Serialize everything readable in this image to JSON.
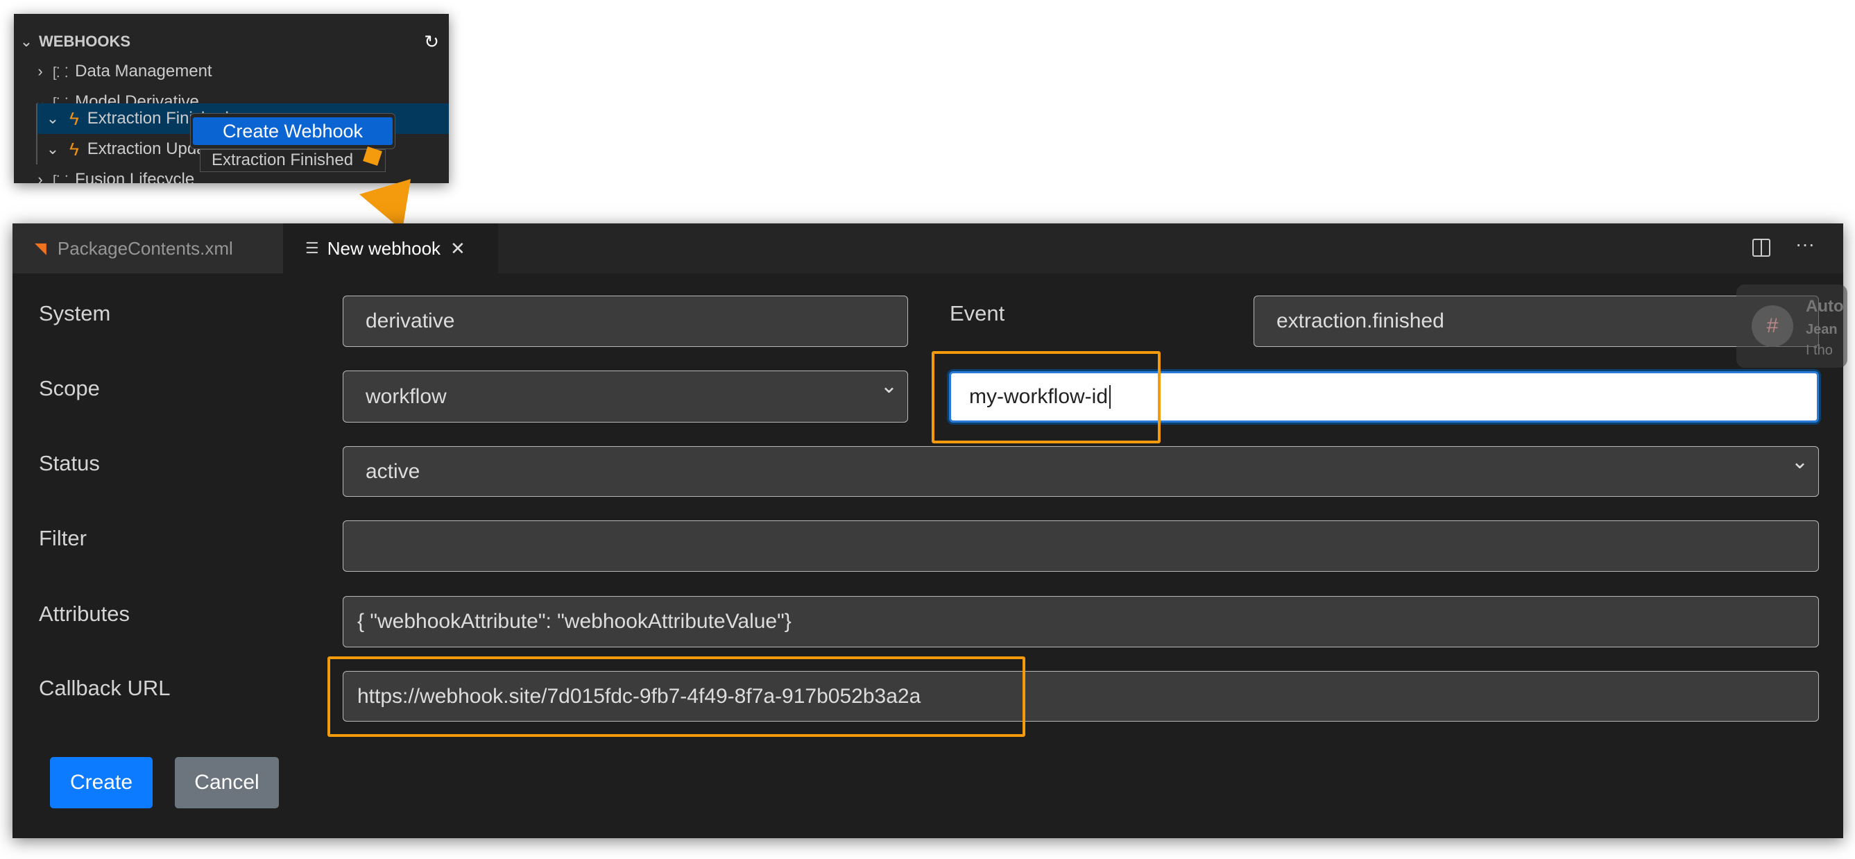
{
  "tree": {
    "section_title": "WEBHOOKS",
    "items": [
      {
        "label": "Data Management"
      },
      {
        "label": "Model Derivative"
      },
      {
        "label": "Extraction Finished"
      },
      {
        "label": "Extraction Updated"
      },
      {
        "label": "Fusion Lifecycle"
      }
    ],
    "context_menu": {
      "item": "Create Webhook"
    },
    "tooltip": "Extraction Finished"
  },
  "tabs": [
    {
      "label": "PackageContents.xml",
      "active": false
    },
    {
      "label": "New webhook",
      "active": true
    }
  ],
  "form": {
    "system": {
      "label": "System",
      "value": "derivative"
    },
    "event": {
      "label": "Event",
      "value": "extraction.finished"
    },
    "scope": {
      "label": "Scope",
      "value": "workflow",
      "scope_value": "my-workflow-id"
    },
    "status": {
      "label": "Status",
      "value": "active"
    },
    "filter": {
      "label": "Filter",
      "value": ""
    },
    "attributes": {
      "label": "Attributes",
      "value": "{ \"webhookAttribute\": \"webhookAttributeValue\"}"
    },
    "callback": {
      "label": "Callback URL",
      "value": "https://webhook.site/7d015fdc-9fb7-4f49-8f7a-917b052b3a2a"
    },
    "create_label": "Create",
    "cancel_label": "Cancel"
  },
  "notification": {
    "title": "Auto",
    "sender": "Jean",
    "text": "I tho"
  },
  "colors": {
    "accent": "#0d7bff",
    "highlight": "#f39a0d",
    "cancel": "#6c757d"
  }
}
